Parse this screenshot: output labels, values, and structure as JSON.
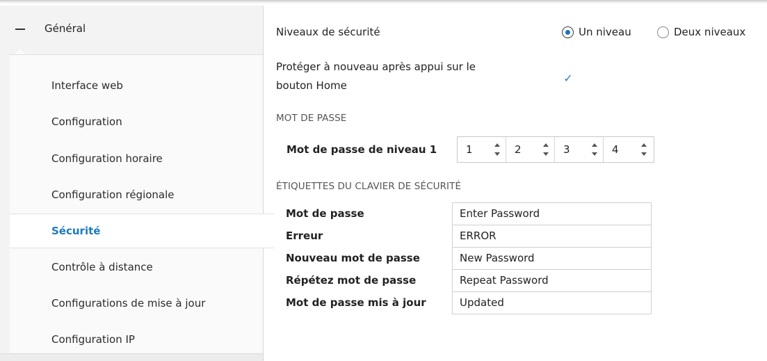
{
  "sidebar": {
    "group_label": "Général",
    "items": [
      {
        "label": "Interface web",
        "active": false
      },
      {
        "label": "Configuration",
        "active": false
      },
      {
        "label": "Configuration horaire",
        "active": false
      },
      {
        "label": "Configuration régionale",
        "active": false
      },
      {
        "label": "Sécurité",
        "active": true
      },
      {
        "label": "Contrôle à distance",
        "active": false
      },
      {
        "label": "Configurations de mise à jour",
        "active": false
      },
      {
        "label": "Configuration IP",
        "active": false
      }
    ]
  },
  "main": {
    "security_levels": {
      "label": "Niveaux de sécurité",
      "options": [
        {
          "label": "Un niveau",
          "checked": true
        },
        {
          "label": "Deux niveaux",
          "checked": false
        }
      ]
    },
    "reprotect": {
      "label_line1": "Protéger à nouveau après appui sur le",
      "label_line2": "bouton Home",
      "checked": true
    },
    "password_section": "MOT DE PASSE",
    "level1": {
      "label": "Mot de passe de niveau 1",
      "digits": [
        "1",
        "2",
        "3",
        "4"
      ]
    },
    "keypad_section": "ÉTIQUETTES DU CLAVIER DE SÉCURITÉ",
    "keypad_labels": [
      {
        "key": "Mot de passe",
        "value": "Enter Password"
      },
      {
        "key": "Erreur",
        "value": "ERROR"
      },
      {
        "key": "Nouveau mot de passe",
        "value": "New Password"
      },
      {
        "key": "Répétez mot de passe",
        "value": "Repeat Password"
      },
      {
        "key": "Mot de passe mis à jour",
        "value": "Updated"
      }
    ]
  },
  "colors": {
    "accent": "#1e7abf",
    "check": "#2a7dd1"
  }
}
